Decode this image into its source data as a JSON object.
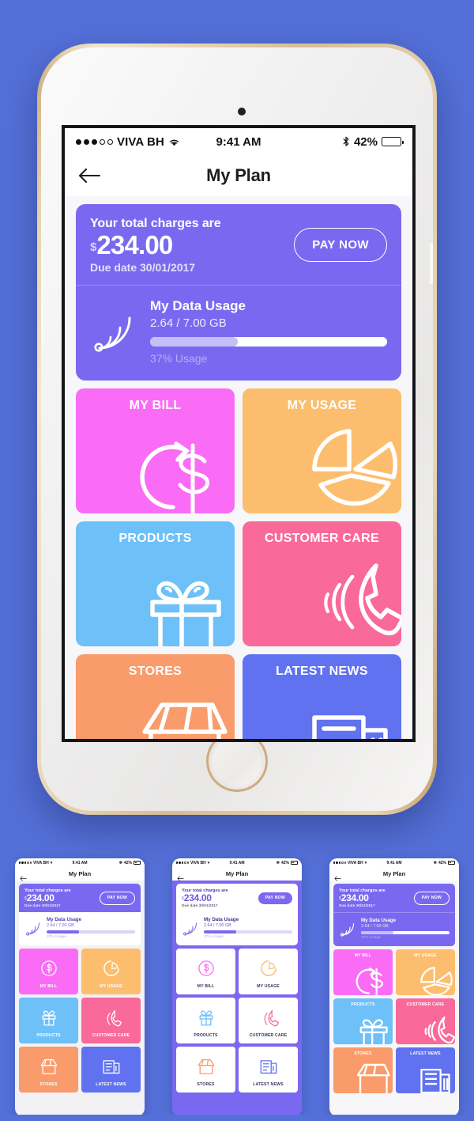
{
  "background_color": "#5470d8",
  "device": {
    "frame_color": "#d8bd93",
    "body_color": "#f2f1ef"
  },
  "status_bar": {
    "carrier": "VIVA BH",
    "signal_dots_filled": 3,
    "signal_dots_total": 5,
    "wifi_icon": "wifi-icon",
    "time": "9:41 AM",
    "bluetooth_icon": "bluetooth-icon",
    "battery_percent": "42%",
    "battery_level": 42
  },
  "nav": {
    "back_icon": "arrow-left-icon",
    "title": "My Plan"
  },
  "plan_card": {
    "background": "#7b68f0",
    "charges_label": "Your total charges are",
    "currency": "$",
    "amount": "234.00",
    "due_date": "Due date 30/01/2017",
    "pay_button": "PAY NOW"
  },
  "data_usage": {
    "icon": "wifi-signal-icon",
    "title": "My Data Usage",
    "value": "2.64 / 7.00 GB",
    "used_gb": 2.64,
    "total_gb": 7.0,
    "percent": 37,
    "percent_label": "37% Usage",
    "bar_fill_color": "#c6bff5",
    "bar_track_color": "#ffffff"
  },
  "tiles": [
    {
      "label": "MY BILL",
      "color": "#fa6cf5",
      "icon": "bill-refresh-dollar-icon"
    },
    {
      "label": "MY USAGE",
      "color": "#fcbe6e",
      "icon": "pie-chart-icon"
    },
    {
      "label": "PRODUCTS",
      "color": "#6ec0f8",
      "icon": "gift-box-icon"
    },
    {
      "label": "CUSTOMER CARE",
      "color": "#f9699a",
      "icon": "ringing-phone-icon"
    },
    {
      "label": "STORES",
      "color": "#f99b6a",
      "icon": "storefront-icon"
    },
    {
      "label": "LATEST NEWS",
      "color": "#6072ef",
      "icon": "newspaper-icon"
    }
  ],
  "thumbnails": [
    {
      "variant": "light",
      "page_background": "#f2f2f4",
      "header_background": "#7b68f0",
      "header_text": "#ffffff",
      "usage_card_background": "#ffffff",
      "usage_text": "#6b5ce0",
      "bar_track": "#d9d4f7",
      "bar_fill": "#7b68f0",
      "pay_style": "outline-white",
      "tile_style": "filled",
      "tile_label_pos": "bottom"
    },
    {
      "variant": "purple",
      "page_background": "#7b68f0",
      "header_background": "#ffffff",
      "header_text": "#5b4bd6",
      "usage_card_background": "#ffffff",
      "usage_text": "#5b4bd6",
      "bar_track": "#ded9f9",
      "bar_fill": "#7b68f0",
      "pay_style": "filled-purple",
      "tile_style": "outline",
      "tile_label_pos": "bottom"
    },
    {
      "variant": "default",
      "page_background": "#f7f7f9",
      "header_background": "#7b68f0",
      "header_text": "#ffffff",
      "usage_card_background": "#7b68f0",
      "usage_text": "#ffffff",
      "bar_track": "#ffffff",
      "bar_fill": "#c6bff5",
      "pay_style": "outline-white",
      "tile_style": "filled",
      "tile_label_pos": "top"
    }
  ]
}
